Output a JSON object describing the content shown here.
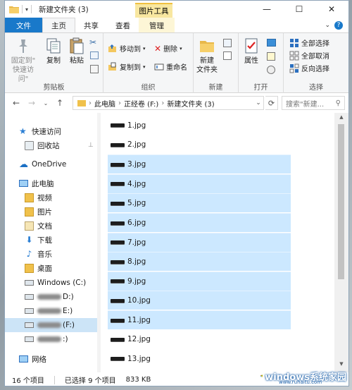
{
  "window": {
    "title": "新建文件夹 (3)",
    "context_tab_header": "图片工具",
    "controls": [
      "—",
      "☐",
      "✕"
    ]
  },
  "ribbon_tabs": {
    "file": "文件",
    "home": "主页",
    "share": "共享",
    "view": "查看",
    "manage": "管理"
  },
  "ribbon": {
    "clipboard": {
      "pin_line1": "固定到\"",
      "pin_line2": "快速访问\"",
      "copy": "复制",
      "paste": "粘贴",
      "label": "剪贴板"
    },
    "organize": {
      "move_to": "移动到",
      "copy_to": "复制到",
      "delete": "删除",
      "rename": "重命名",
      "label": "组织"
    },
    "new": {
      "new_folder_line1": "新建",
      "new_folder_line2": "文件夹",
      "label": "新建"
    },
    "open": {
      "properties": "属性",
      "label": "打开"
    },
    "select": {
      "select_all": "全部选择",
      "select_none": "全部取消",
      "invert": "反向选择",
      "label": "选择"
    }
  },
  "address": {
    "crumbs": [
      "此电脑",
      "正经卷 (F:)",
      "新建文件夹 (3)"
    ],
    "search_placeholder": "搜索\"新建..."
  },
  "nav": {
    "quick_access": "快速访问",
    "recycle_bin": "回收站",
    "onedrive": "OneDrive",
    "this_pc": "此电脑",
    "videos": "视频",
    "pictures": "图片",
    "documents": "文档",
    "downloads": "下载",
    "music": "音乐",
    "desktop": "桌面",
    "windows_c": "Windows (C:)",
    "drive_d": "D:)",
    "drive_e": "E:)",
    "drive_f": "(F:)",
    "drive_g": ":)",
    "network": "网络"
  },
  "files": [
    {
      "name": "1.jpg",
      "selected": false
    },
    {
      "name": "2.jpg",
      "selected": false
    },
    {
      "name": "3.jpg",
      "selected": true
    },
    {
      "name": "4.jpg",
      "selected": true
    },
    {
      "name": "5.jpg",
      "selected": true
    },
    {
      "name": "6.jpg",
      "selected": true
    },
    {
      "name": "7.jpg",
      "selected": true
    },
    {
      "name": "8.jpg",
      "selected": true
    },
    {
      "name": "9.jpg",
      "selected": true
    },
    {
      "name": "10.jpg",
      "selected": true
    },
    {
      "name": "11.jpg",
      "selected": true
    },
    {
      "name": "12.jpg",
      "selected": false
    },
    {
      "name": "13.jpg",
      "selected": false
    }
  ],
  "status": {
    "item_count": "16 个项目",
    "selected_count": "已选择 9 个项目",
    "size": "833 KB"
  },
  "watermark": {
    "brand": "windows系统家园",
    "url": "www.ruhaitu.com"
  },
  "colors": {
    "file_tab": "#1979ca",
    "selection": "#cce8ff",
    "context_tab": "#f8e7a0"
  }
}
